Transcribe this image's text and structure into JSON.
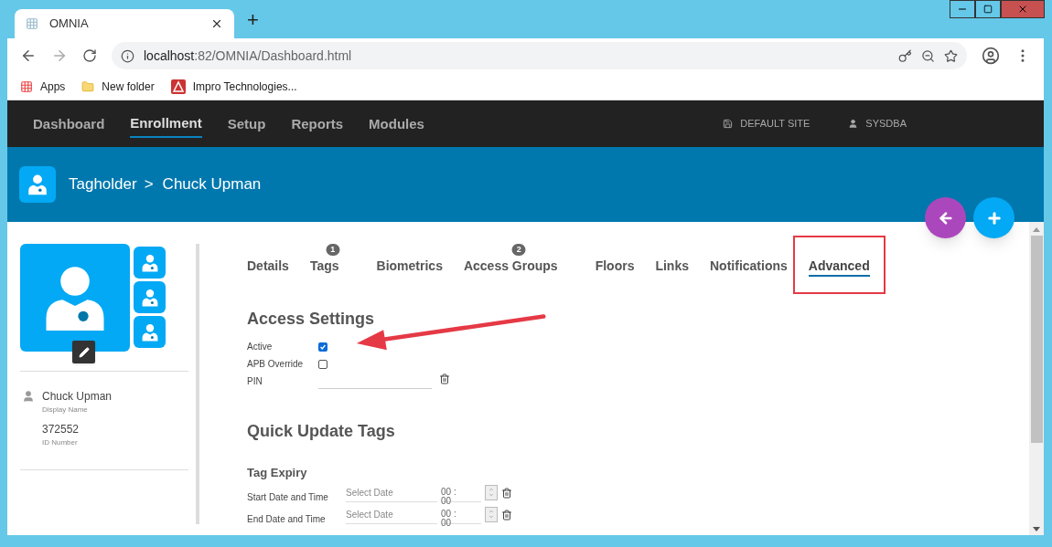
{
  "browser": {
    "tab_title": "OMNIA",
    "new_tab": "+",
    "address_host": "localhost",
    "address_rest": ":82/OMNIA/Dashboard.html",
    "bookmarks": [
      "Apps",
      "New folder",
      "Impro Technologies..."
    ]
  },
  "nav": {
    "items": [
      {
        "label": "Dashboard",
        "selected": false
      },
      {
        "label": "Enrollment",
        "selected": true
      },
      {
        "label": "Setup",
        "selected": false
      },
      {
        "label": "Reports",
        "selected": false
      },
      {
        "label": "Modules",
        "selected": false
      }
    ],
    "site": "DEFAULT SITE",
    "user": "SYSDBA"
  },
  "header": {
    "section": "Tagholder",
    "separator": ">",
    "name": "Chuck Upman"
  },
  "profile": {
    "name": "Chuck Upman",
    "name_label": "Display Name",
    "id": "372552",
    "id_label": "ID Number"
  },
  "tabs": [
    {
      "label": "Details",
      "selected": false
    },
    {
      "label": "Tags",
      "badge": "1",
      "selected": false
    },
    {
      "label": "Biometrics",
      "selected": false
    },
    {
      "label": "Access Groups",
      "badge": "2",
      "selected": false
    },
    {
      "label": "Floors",
      "selected": false
    },
    {
      "label": "Links",
      "selected": false
    },
    {
      "label": "Notifications",
      "selected": false
    },
    {
      "label": "Advanced",
      "selected": true
    }
  ],
  "access_settings": {
    "title": "Access Settings",
    "fields": [
      {
        "kind": "checkbox",
        "label": "Active",
        "checked": true
      },
      {
        "kind": "checkbox",
        "label": "APB Override",
        "checked": false
      },
      {
        "kind": "text",
        "label": "PIN"
      }
    ]
  },
  "quick_update": {
    "title": "Quick Update Tags",
    "subtitle": "Tag Expiry",
    "rows": [
      {
        "label": "Start Date and Time",
        "placeholder": "Select Date",
        "time": "00 : 00"
      },
      {
        "label": "End Date and Time",
        "placeholder": "Select Date",
        "time": "00 : 00"
      }
    ]
  }
}
